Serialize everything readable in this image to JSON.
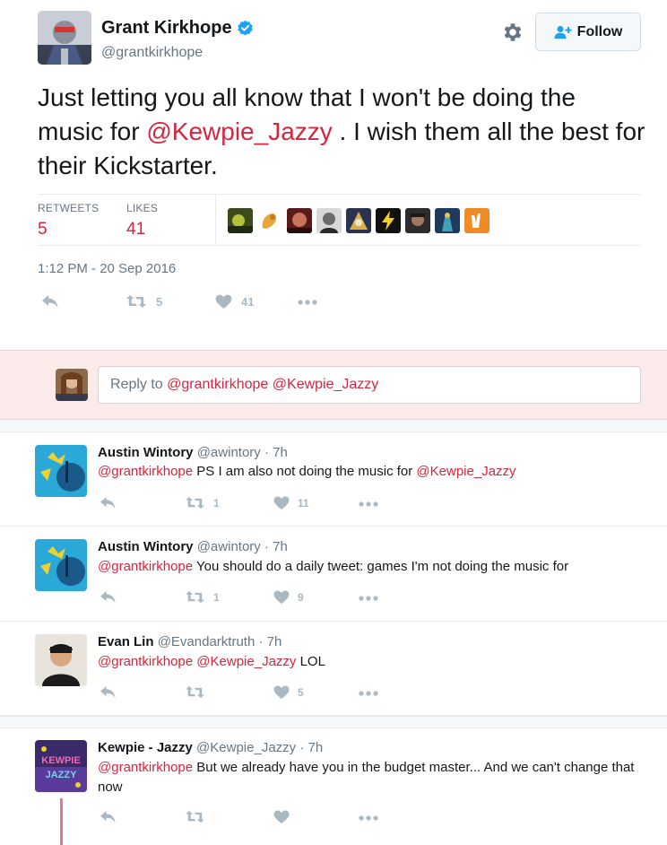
{
  "tweet": {
    "author_name": "Grant Kirkhope",
    "author_handle": "@grantkirkhope",
    "follow_label": "Follow",
    "text_before": "Just letting you all know that I won't be doing the music for ",
    "text_mention": "@Kewpie_Jazzy",
    "text_after": " . I wish them all the best for their Kickstarter.",
    "retweets_label": "RETWEETS",
    "retweets_value": "5",
    "likes_label": "LIKES",
    "likes_value": "41",
    "timestamp": "1:12 PM - 20 Sep 2016",
    "action_retweet_count": "5",
    "action_like_count": "41"
  },
  "reply_box": {
    "prefix": "Reply to ",
    "mentions": "@grantkirkhope @Kewpie_Jazzy"
  },
  "replies": [
    {
      "name": "Austin Wintory",
      "handle": "@awintory",
      "time": " · 7h",
      "mention1": "@grantkirkhope",
      "text": "  PS I am also not doing the music for ",
      "mention2": "@Kewpie_Jazzy",
      "text2": "",
      "retweets": "1",
      "likes": "11"
    },
    {
      "name": "Austin Wintory",
      "handle": "@awintory",
      "time": " · 7h",
      "mention1": "@grantkirkhope",
      "text": " You should do a daily tweet: games I'm not doing the music for",
      "mention2": "",
      "text2": "",
      "retweets": "1",
      "likes": "9"
    },
    {
      "name": "Evan Lin",
      "handle": "@Evandarktruth",
      "time": " · 7h",
      "mention1": "@grantkirkhope",
      "text": " ",
      "mention2": "@Kewpie_Jazzy",
      "text2": " LOL",
      "retweets": "",
      "likes": "5"
    },
    {
      "name": "Kewpie - Jazzy",
      "handle": "@Kewpie_Jazzy",
      "time": " · 7h",
      "mention1": "@grantkirkhope",
      "text": " But we already have you in the budget master... And we can't change that now",
      "mention2": "",
      "text2": "",
      "retweets": "",
      "likes": ""
    }
  ],
  "colors": {
    "accent": "#d4263e",
    "muted": "#657786",
    "icon": "#aab8c2",
    "reply_bg": "#fbeaea",
    "verified": "#1da1f2"
  },
  "icons": [
    "verified-badge-icon",
    "gear-icon",
    "follow-person-plus-icon",
    "reply-icon",
    "retweet-icon",
    "like-heart-icon",
    "more-dots-icon"
  ]
}
